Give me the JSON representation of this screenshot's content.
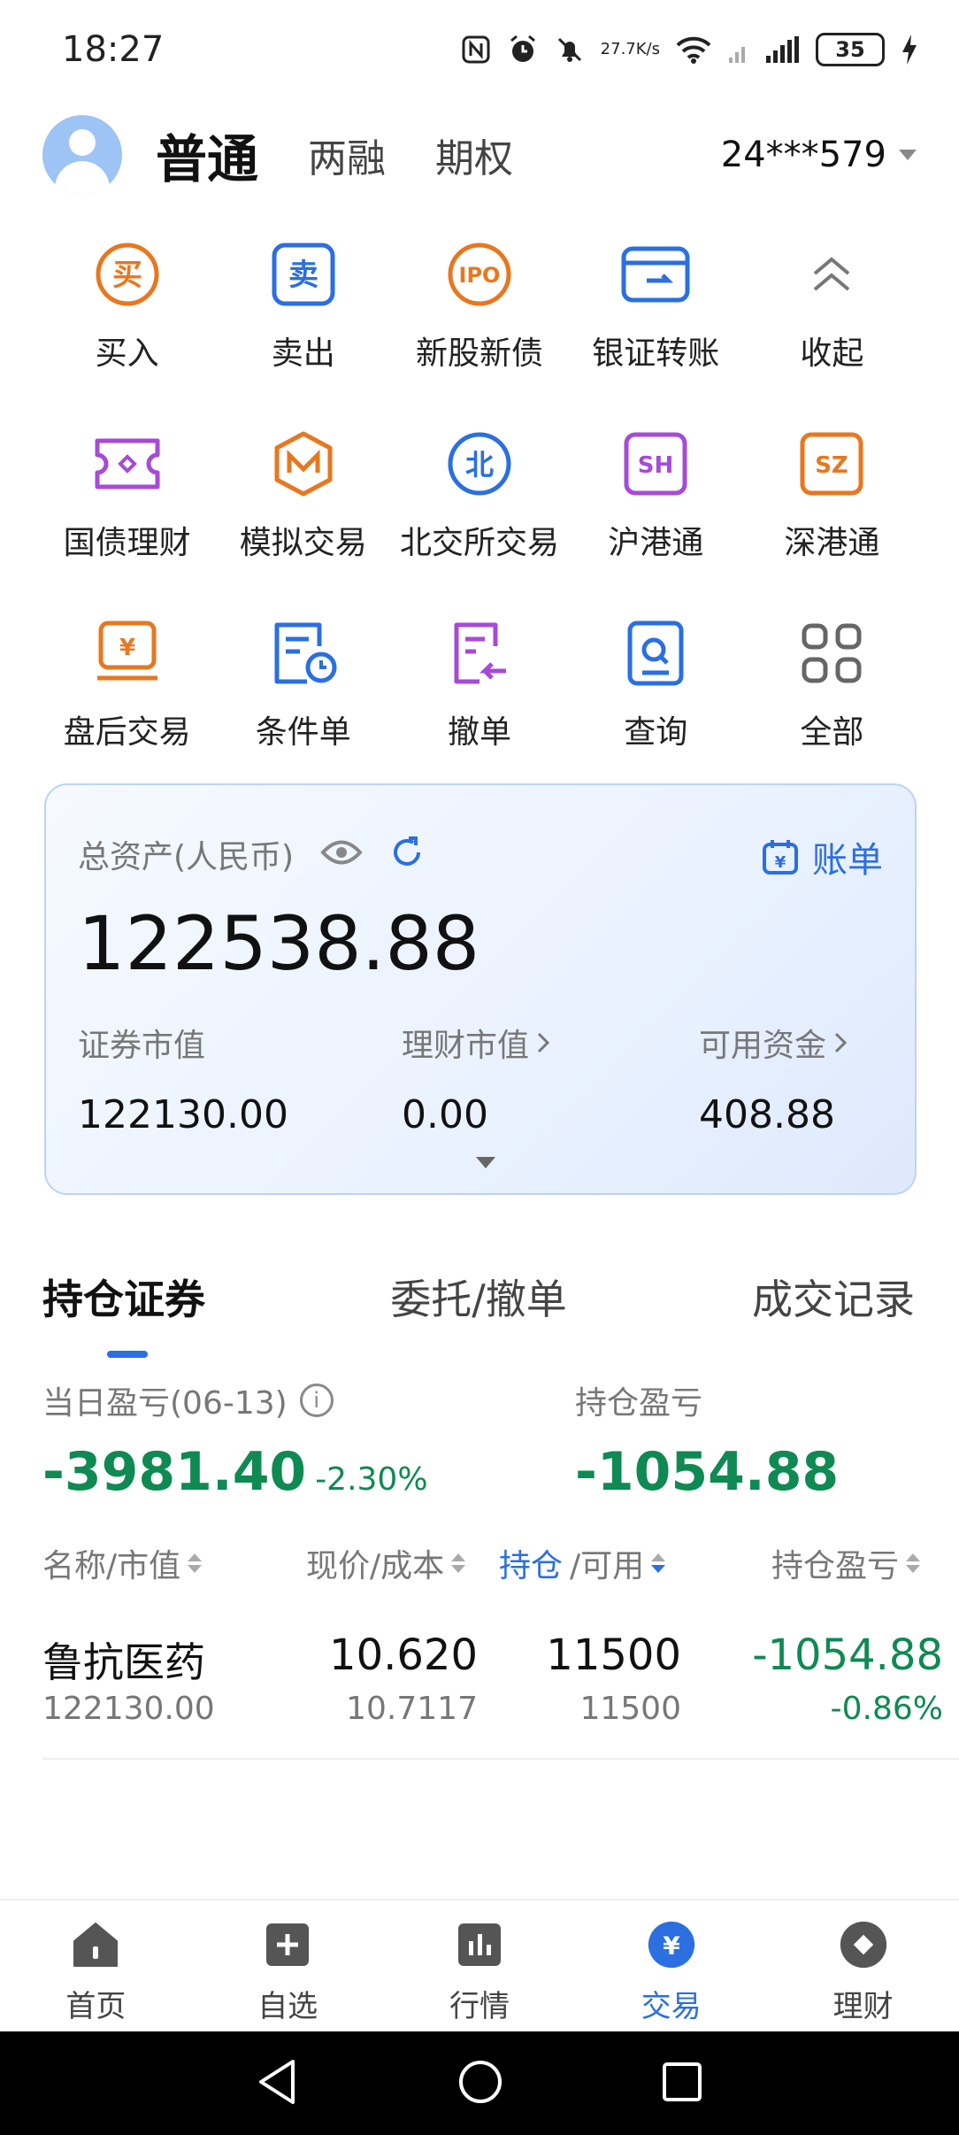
{
  "status_bar": {
    "time": "18:27",
    "speed_top": "27.7",
    "speed_bottom": "K/s",
    "battery": "35"
  },
  "header": {
    "tabs": [
      "普通",
      "两融",
      "期权"
    ],
    "account": "24***579"
  },
  "functions": [
    {
      "label": "买入",
      "icon": "buy-icon",
      "color": "#e8771f"
    },
    {
      "label": "卖出",
      "icon": "sell-icon",
      "color": "#2b6fe0"
    },
    {
      "label": "新股新债",
      "icon": "ipo-icon",
      "color": "#e8771f"
    },
    {
      "label": "银证转账",
      "icon": "bank-card-icon",
      "color": "#2b6fe0"
    },
    {
      "label": "收起",
      "icon": "chevron-up-icon",
      "color": "#666666"
    },
    {
      "label": "国债理财",
      "icon": "ticket-icon",
      "color": "#a64ad8"
    },
    {
      "label": "模拟交易",
      "icon": "simulate-icon",
      "color": "#e8771f"
    },
    {
      "label": "北交所交易",
      "icon": "bse-icon",
      "color": "#2b6fe0"
    },
    {
      "label": "沪港通",
      "icon": "sh-icon",
      "color": "#a64ad8"
    },
    {
      "label": "深港通",
      "icon": "sz-icon",
      "color": "#e8771f"
    },
    {
      "label": "盘后交易",
      "icon": "after-hours-icon",
      "color": "#e8771f"
    },
    {
      "label": "条件单",
      "icon": "condition-order-icon",
      "color": "#2b6fe0"
    },
    {
      "label": "撤单",
      "icon": "cancel-order-icon",
      "color": "#a64ad8"
    },
    {
      "label": "查询",
      "icon": "query-icon",
      "color": "#2b6fe0"
    },
    {
      "label": "全部",
      "icon": "all-grid-icon",
      "color": "#666666"
    }
  ],
  "assets": {
    "title": "总资产(人民币)",
    "bill_label": "账单",
    "total": "122538.88",
    "securities_label": "证券市值",
    "securities_value": "122130.00",
    "wealth_label": "理财市值",
    "wealth_value": "0.00",
    "cash_label": "可用资金",
    "cash_value": "408.88"
  },
  "holding_tabs": [
    "持仓证券",
    "委托/撤单",
    "成交记录"
  ],
  "pnl": {
    "daily_label": "当日盈亏(06-13)",
    "daily_value": "-3981.40",
    "daily_pct": "-2.30%",
    "position_label": "持仓盈亏",
    "position_value": "-1054.88"
  },
  "columns": {
    "name": "名称/市值",
    "price": "现价/成本",
    "hold_hl": "持仓",
    "hold_rest": "/可用",
    "pnl": "持仓盈亏"
  },
  "holdings": [
    {
      "name": "鲁抗医药",
      "market_value": "122130.00",
      "price": "10.620",
      "cost": "10.7117",
      "position": "11500",
      "available": "11500",
      "pnl": "-1054.88",
      "pnl_pct": "-0.86%"
    }
  ],
  "bottom_nav": [
    "首页",
    "自选",
    "行情",
    "交易",
    "理财"
  ],
  "colors": {
    "accent": "#2b6fe0",
    "loss_green": "#0e8a52"
  }
}
